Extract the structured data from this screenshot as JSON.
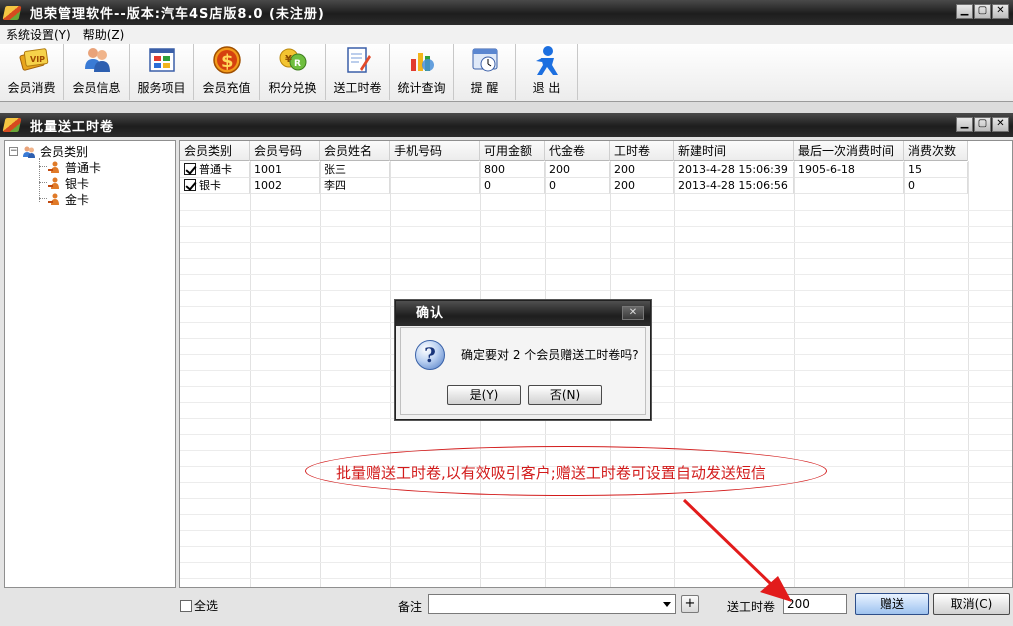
{
  "window": {
    "title": "旭荣管理软件--版本:汽车4S店版8.0 (未注册)",
    "controls": {
      "minimize": "▁",
      "maximize": "▢",
      "close": "✕"
    }
  },
  "menu": [
    {
      "label": "系统设置(Y)"
    },
    {
      "label": "帮助(Z)"
    }
  ],
  "toolbar": [
    {
      "label": "会员消费",
      "icon": "vip-card-icon"
    },
    {
      "label": "会员信息",
      "icon": "members-icon"
    },
    {
      "label": "服务项目",
      "icon": "grid-window-icon"
    },
    {
      "label": "会员充值",
      "icon": "dollar-coin-icon"
    },
    {
      "label": "积分兑换",
      "icon": "points-exchange-icon"
    },
    {
      "label": "送工时卷",
      "icon": "document-edit-icon"
    },
    {
      "label": "统计查询",
      "icon": "statistics-icon"
    },
    {
      "label": "提 醒",
      "icon": "reminder-icon"
    },
    {
      "label": "退 出",
      "icon": "exit-person-icon"
    }
  ],
  "inner_window": {
    "title": "批量送工时卷"
  },
  "tree": {
    "root": "会员类别",
    "root_expander": "−",
    "children": [
      "普通卡",
      "银卡",
      "金卡"
    ]
  },
  "grid": {
    "columns": [
      "会员类别",
      "会员号码",
      "会员姓名",
      "手机号码",
      "可用金额",
      "代金卷",
      "工时卷",
      "新建时间",
      "最后一次消费时间",
      "消费次数"
    ],
    "rows": [
      {
        "checked": true,
        "cells": [
          "普通卡",
          "1001",
          "张三",
          "",
          "800",
          "200",
          "200",
          "2013-4-28 15:06:39",
          "1905-6-18",
          "15"
        ]
      },
      {
        "checked": true,
        "cells": [
          "银卡",
          "1002",
          "李四",
          "",
          "0",
          "0",
          "200",
          "2013-4-28 15:06:56",
          "",
          "0"
        ]
      }
    ]
  },
  "footer": {
    "select_all": "全选",
    "remark_label": "备注",
    "remark_value": "",
    "plus": "+",
    "hours_label": "送工时卷",
    "hours_value": "200",
    "give_button": "赠送",
    "cancel_button": "取消(C)"
  },
  "dialog": {
    "title": "确认",
    "close": "✕",
    "message": "确定要对 2 个会员赠送工时卷吗?",
    "yes_button": "是(Y)",
    "no_button": "否(N)"
  },
  "annotation": {
    "text": "批量赠送工时卷,以有效吸引客户;赠送工时卷可设置自动发送短信",
    "color": "#d21b1b"
  }
}
